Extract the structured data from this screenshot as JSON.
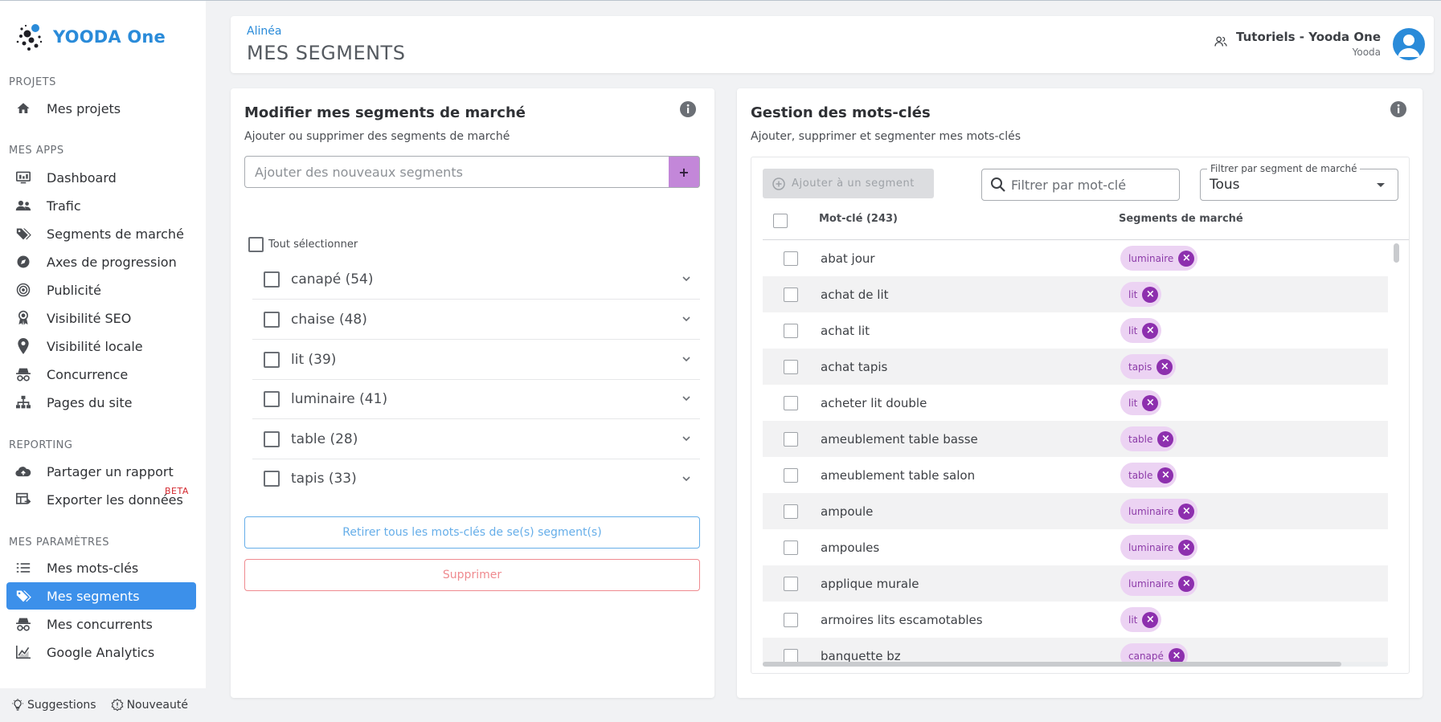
{
  "brand": {
    "name": "YOODA One"
  },
  "sidebar": {
    "sections": [
      {
        "title": "PROJETS",
        "items": [
          {
            "label": "Mes projets",
            "icon": "home-icon"
          }
        ]
      },
      {
        "title": "MES APPS",
        "items": [
          {
            "label": "Dashboard",
            "icon": "dashboard-icon"
          },
          {
            "label": "Trafic",
            "icon": "people-icon"
          },
          {
            "label": "Segments de marché",
            "icon": "tags-icon"
          },
          {
            "label": "Axes de progression",
            "icon": "compass-icon"
          },
          {
            "label": "Publicité",
            "icon": "target-icon"
          },
          {
            "label": "Visibilité SEO",
            "icon": "award-icon"
          },
          {
            "label": "Visibilité locale",
            "icon": "pin-icon"
          },
          {
            "label": "Concurrence",
            "icon": "spy-icon"
          },
          {
            "label": "Pages du site",
            "icon": "sitemap-icon"
          }
        ]
      },
      {
        "title": "REPORTING",
        "items": [
          {
            "label": "Partager un rapport",
            "icon": "cloud-upload-icon"
          },
          {
            "label": "Exporter les données",
            "icon": "table-export-icon",
            "badge": "BETA"
          }
        ]
      },
      {
        "title": "MES PARAMÈTRES",
        "items": [
          {
            "label": "Mes mots-clés",
            "icon": "list-icon"
          },
          {
            "label": "Mes segments",
            "icon": "tags-icon",
            "active": true
          },
          {
            "label": "Mes concurrents",
            "icon": "spy-icon"
          },
          {
            "label": "Google Analytics",
            "icon": "chart-icon"
          }
        ]
      }
    ],
    "footer": {
      "suggestions": "Suggestions",
      "news": "Nouveauté"
    }
  },
  "header": {
    "breadcrumb": "Alinéa",
    "title": "MES SEGMENTS",
    "user_name": "Tutoriels - Yooda One",
    "user_org": "Yooda"
  },
  "left_panel": {
    "title": "Modifier mes segments de marché",
    "subtitle": "Ajouter ou supprimer des segments de marché",
    "input_placeholder": "Ajouter des nouveaux segments",
    "add_label": "+",
    "select_all": "Tout sélectionner",
    "segments": [
      "canapé (54)",
      "chaise (48)",
      "lit (39)",
      "luminaire (41)",
      "table (28)",
      "tapis (33)"
    ],
    "remove_keywords_button": "Retirer tous les mots-clés de se(s) segment(s)",
    "delete_button": "Supprimer"
  },
  "right_panel": {
    "title": "Gestion des mots-clés",
    "subtitle": "Ajouter, supprimer et segmenter mes mots-clés",
    "add_to_segment_button": "Ajouter à un segment",
    "search_placeholder": "Filtrer par mot-clé",
    "filter_label": "Filtrer par segment de marché",
    "filter_value": "Tous",
    "col_keyword": "Mot-clé (243)",
    "col_segments": "Segments de marché",
    "rows": [
      {
        "keyword": "abat jour",
        "segment": "luminaire"
      },
      {
        "keyword": "achat de lit",
        "segment": "lit"
      },
      {
        "keyword": "achat lit",
        "segment": "lit"
      },
      {
        "keyword": "achat tapis",
        "segment": "tapis"
      },
      {
        "keyword": "acheter lit double",
        "segment": "lit"
      },
      {
        "keyword": "ameublement table basse",
        "segment": "table"
      },
      {
        "keyword": "ameublement table salon",
        "segment": "table"
      },
      {
        "keyword": "ampoule",
        "segment": "luminaire"
      },
      {
        "keyword": "ampoules",
        "segment": "luminaire"
      },
      {
        "keyword": "applique murale",
        "segment": "luminaire"
      },
      {
        "keyword": "armoires lits escamotables",
        "segment": "lit"
      },
      {
        "keyword": "banquette bz",
        "segment": "canapé"
      }
    ]
  },
  "colors": {
    "accent": "#3c90ea",
    "chip_bg": "#ecd3f3",
    "chip_x": "#8d2fae",
    "add_btn": "#c387d9"
  }
}
